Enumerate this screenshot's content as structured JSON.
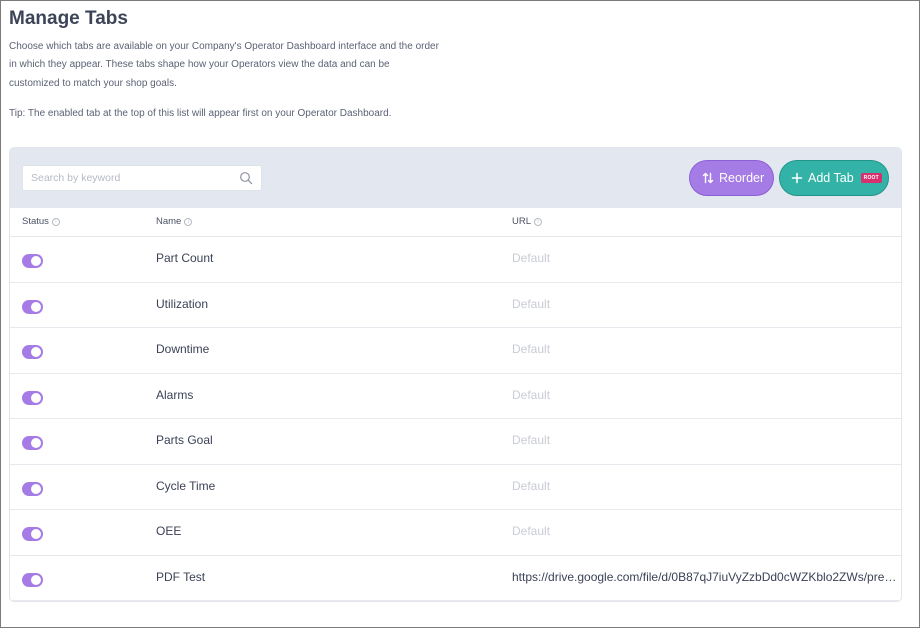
{
  "header": {
    "title": "Manage Tabs",
    "description": "Choose which tabs are available on your Company's Operator Dashboard interface and the order in which they appear. These tabs shape how your Operators view the data and can be customized to match your shop goals.",
    "tip": "Tip: The enabled tab at the top of this list will appear first on your Operator Dashboard."
  },
  "toolbar": {
    "search_placeholder": "Search by keyword",
    "reorder_label": "Reorder",
    "add_tab_label": "Add Tab",
    "root_badge": "ROOT"
  },
  "colors": {
    "accent_purple": "#a57be6",
    "accent_teal": "#33b3a8",
    "badge_pink": "#d6306e"
  },
  "table": {
    "columns": {
      "status": "Status",
      "name": "Name",
      "url": "URL"
    },
    "rows": [
      {
        "enabled": true,
        "name": "Part Count",
        "url": "Default",
        "is_default": true
      },
      {
        "enabled": true,
        "name": "Utilization",
        "url": "Default",
        "is_default": true
      },
      {
        "enabled": true,
        "name": "Downtime",
        "url": "Default",
        "is_default": true
      },
      {
        "enabled": true,
        "name": "Alarms",
        "url": "Default",
        "is_default": true
      },
      {
        "enabled": true,
        "name": "Parts Goal",
        "url": "Default",
        "is_default": true
      },
      {
        "enabled": true,
        "name": "Cycle Time",
        "url": "Default",
        "is_default": true
      },
      {
        "enabled": true,
        "name": "OEE",
        "url": "Default",
        "is_default": true
      },
      {
        "enabled": true,
        "name": "PDF Test",
        "url": "https://drive.google.com/file/d/0B87qJ7iuVyZzbDd0cWZKblo2ZWs/pre…",
        "is_default": false
      }
    ]
  }
}
